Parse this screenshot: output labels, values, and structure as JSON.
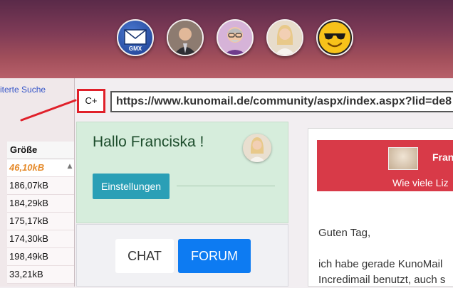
{
  "sidebar": {
    "search_link": "iterte Suche",
    "table": {
      "header": "Größe",
      "rows": [
        "46,10kB",
        "186,07kB",
        "184,29kB",
        "175,17kB",
        "174,30kB",
        "198,49kB",
        "33,21kB"
      ]
    }
  },
  "toolbar": {
    "cplus_label": "C+",
    "url": "https://www.kunomail.de/community/aspx/index.aspx?lid=de8"
  },
  "avatars": [
    {
      "label": "GMX"
    }
  ],
  "welcome": {
    "title": "Hallo Franciska !",
    "settings_label": "Einstellungen"
  },
  "nav": {
    "chat_label": "CHAT",
    "forum_label": "FORUM"
  },
  "mail": {
    "sender": "Fran",
    "subject": "Wie viele Liz",
    "body": [
      "Guten Tag,",
      "",
      "ich habe gerade KunoMail",
      "Incredimail benutzt, auch s"
    ]
  },
  "colors": {
    "accent_red": "#e0202a",
    "forum_blue": "#0d7bf2",
    "settings_teal": "#2a9fb6",
    "mail_header_red": "#d83a48",
    "highlight_orange": "#e58a2a"
  }
}
